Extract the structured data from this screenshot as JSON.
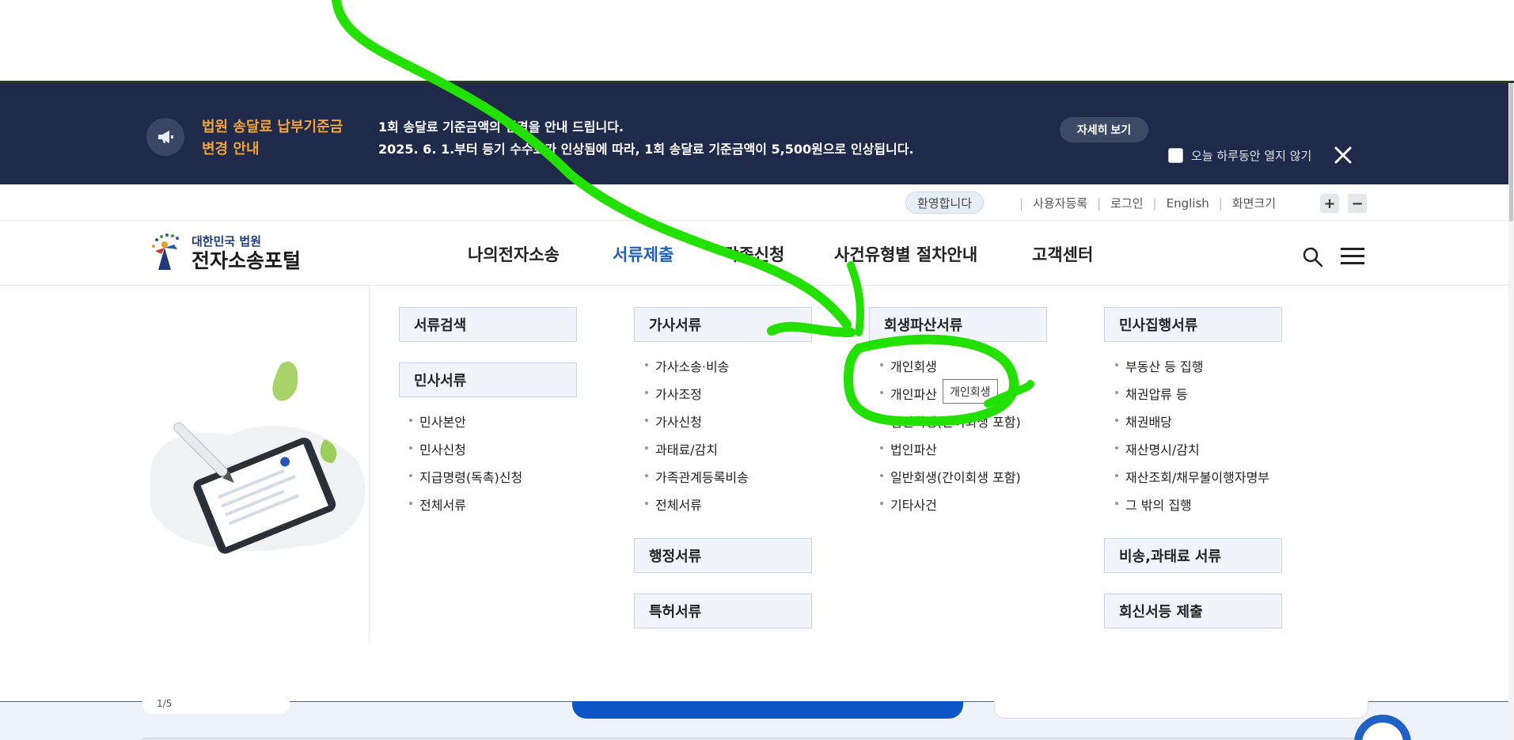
{
  "notice": {
    "title_line1": "법원 송달료 납부기준금",
    "title_line2": "변경 안내",
    "text_line1": "1회 송달료 기준금액의 변경을 안내 드립니다.",
    "text_line2": "2025. 6. 1.부터 등기 수수료가 인상됨에 따라, 1회 송달료 기준금액이 5,500원으로 인상됩니다.",
    "detail_button": "자세히 보기",
    "today_checkbox_label": "오늘 하루동안 열지 않기",
    "today_checked": false
  },
  "util": {
    "welcome": "환영합니다",
    "links": [
      "사용자등록",
      "로그인",
      "English",
      "화면크기"
    ],
    "zoom_in": "+",
    "zoom_out": "−"
  },
  "header": {
    "logo_small": "대한민국 법원",
    "logo_big": "전자소송포털",
    "nav": [
      "나의전자소송",
      "서류제출",
      "각종신청",
      "사건유형별 절차안내",
      "고객센터"
    ],
    "active_nav": "서류제출"
  },
  "mega": {
    "col1": {
      "cat1": "서류검색",
      "cat2": "민사서류",
      "items": [
        "민사본안",
        "민사신청",
        "지급명령(독촉)신청",
        "전체서류"
      ]
    },
    "col2": {
      "cat1": "가사서류",
      "items": [
        "가사소송·비송",
        "가사조정",
        "가사신청",
        "과태료/감치",
        "가족관계등록비송",
        "전체서류"
      ],
      "cat2": "행정서류",
      "cat3": "특허서류"
    },
    "col3": {
      "cat1": "회생파산서류",
      "items": [
        "개인회생",
        "개인파산",
        "법인회생(간이회생 포함)",
        "법인파산",
        "일반회생(간이회생 포함)",
        "기타사건"
      ],
      "tooltip": "개인회생"
    },
    "col4": {
      "cat1": "민사집행서류",
      "items": [
        "부동산 등 집행",
        "채권압류 등",
        "채권배당",
        "재산명시/감치",
        "재산조회/채무불이행자명부",
        "그 밖의 집행"
      ],
      "cat2": "비송,과태료 서류",
      "cat3": "회신서등 제출"
    }
  },
  "below": {
    "page_indicator": "1/5"
  },
  "colors": {
    "banner_bg": "#1f2a4b",
    "banner_title": "#f2a33a",
    "active_nav": "#1e5fbf",
    "annotation": "#22e000"
  }
}
